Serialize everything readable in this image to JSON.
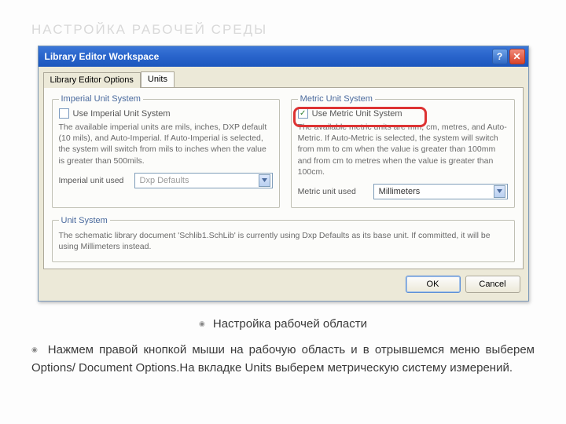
{
  "page": {
    "heading_faded": "НАСТРОЙКА РАБОЧЕЙ СРЕДЫ",
    "caption": "Настройка рабочей области",
    "body": "Нажмем правой кнопкой мыши на рабочую область и в отрывшемся меню выберем Options/ Document Options.На вкладке Units выберем метрическую систему измерений."
  },
  "window": {
    "title": "Library Editor Workspace",
    "tabs": {
      "options": "Library Editor Options",
      "units": "Units"
    },
    "imperial": {
      "legend": "Imperial Unit System",
      "checkbox_label": "Use Imperial Unit System",
      "checked": false,
      "desc": "The available imperial units are mils, inches, DXP default (10 mils), and Auto-Imperial. If Auto-Imperial is selected, the system will switch from mils to inches when the value is greater than 500mils.",
      "field_label": "Imperial unit used",
      "field_value": "Dxp Defaults"
    },
    "metric": {
      "legend": "Metric Unit System",
      "checkbox_label": "Use Metric Unit System",
      "checked": true,
      "desc": "The available metric units are mm, cm,  metres, and Auto-Metric. If Auto-Metric is selected, the system will switch from mm to cm when the value is greater than 100mm and from cm to metres when the value is greater than 100cm.",
      "field_label": "Metric unit used",
      "field_value": "Millimeters"
    },
    "unit_system": {
      "legend": "Unit  System",
      "text": "The schematic library document 'Schlib1.SchLib' is currently using Dxp Defaults as its base unit. If committed, it will be using Millimeters instead."
    },
    "buttons": {
      "ok": "OK",
      "cancel": "Cancel"
    }
  }
}
